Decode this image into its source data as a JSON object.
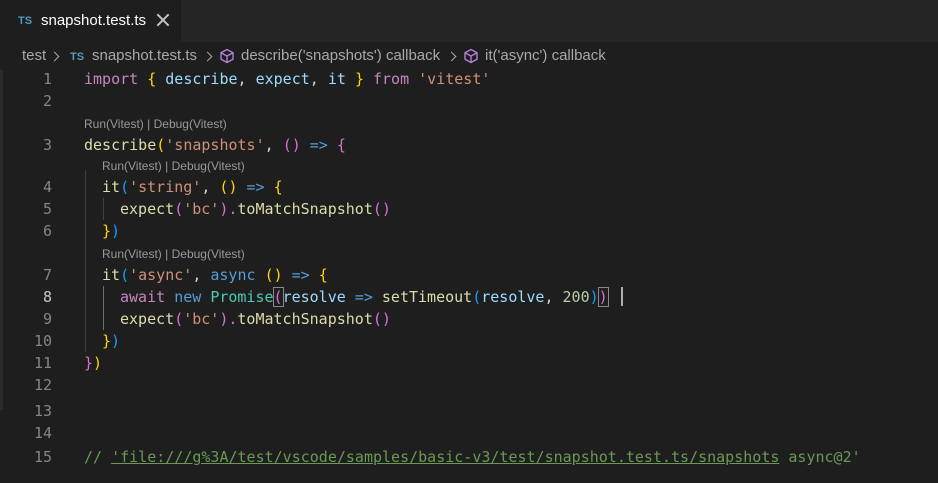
{
  "tab": {
    "lang": "TS",
    "title": "snapshot.test.ts"
  },
  "breadcrumb": {
    "folder": "test",
    "file_lang": "TS",
    "file": "snapshot.test.ts",
    "symbol1": "describe('snapshots') callback",
    "symbol2": "it('async') callback"
  },
  "codelens": {
    "run": "Run(Vitest)",
    "sep": " | ",
    "debug": "Debug(Vitest)"
  },
  "line_numbers": [
    "1",
    "2",
    "3",
    "4",
    "5",
    "6",
    "7",
    "8",
    "9",
    "10",
    "11",
    "12",
    "13",
    "14",
    "15"
  ],
  "active_line": "8",
  "code": {
    "l1": [
      "import",
      " ",
      "{",
      " ",
      "describe",
      ", ",
      "expect",
      ", ",
      "it",
      " ",
      "}",
      " ",
      "from",
      " ",
      "'vitest'"
    ],
    "l3": [
      "describe",
      "(",
      "'snapshots'",
      ", ",
      "(",
      ")",
      " => ",
      "{"
    ],
    "l4": [
      "it",
      "(",
      "'string'",
      ", ",
      "(",
      ")",
      " => ",
      "{"
    ],
    "l5": [
      "expect",
      "(",
      "'bc'",
      ").",
      "toMatchSnapshot",
      "(",
      ")"
    ],
    "l6": [
      "}",
      ")"
    ],
    "l7": [
      "it",
      "(",
      "'async'",
      ", ",
      "async",
      " ",
      "(",
      ")",
      " => ",
      "{"
    ],
    "l8": [
      "await",
      " ",
      "new",
      " ",
      "Promise",
      "(",
      "resolve",
      " => ",
      "setTimeout",
      "(",
      "resolve",
      ", ",
      "200",
      ")",
      ")"
    ],
    "l9": [
      "expect",
      "(",
      "'bc'",
      ").",
      "toMatchSnapshot",
      "(",
      ")"
    ],
    "l10": [
      "}",
      ")"
    ],
    "l11": [
      "}",
      ")"
    ],
    "l15": [
      "// ",
      "'file:///g%3A/test/vscode/samples/basic-v3/test/snapshot.test.ts/snapshots",
      " async@2'"
    ]
  }
}
